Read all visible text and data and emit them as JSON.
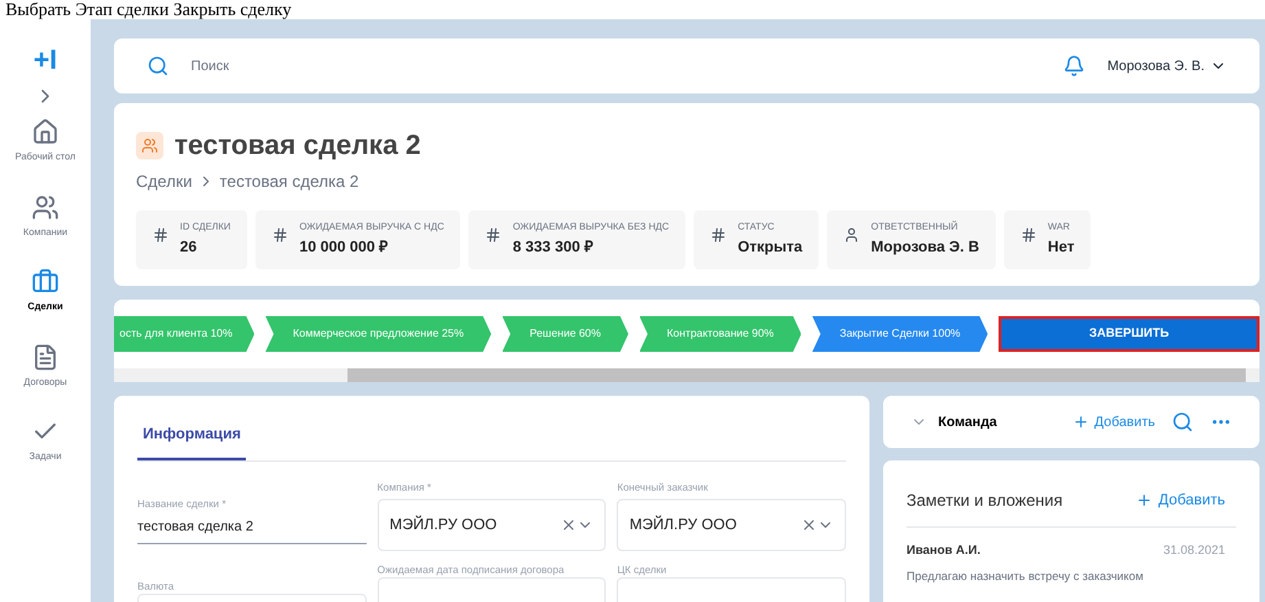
{
  "caption": "Выбрать Этап сделки Закрыть сделку",
  "sidebar": {
    "items": [
      {
        "label": "Рабочий стол",
        "selected": false
      },
      {
        "label": "Компании",
        "selected": false
      },
      {
        "label": "Сделки",
        "selected": true
      },
      {
        "label": "Договоры",
        "selected": false
      },
      {
        "label": "Задачи",
        "selected": false
      }
    ]
  },
  "logo": "+I",
  "search": {
    "placeholder": "Поиск"
  },
  "user": {
    "name": "Морозова Э. В."
  },
  "deal": {
    "title": "тестовая сделка 2",
    "breadcrumbs": [
      "Сделки",
      "тестовая сделка 2"
    ]
  },
  "stats": [
    {
      "label": "ID СДЕЛКИ",
      "value": "26",
      "kind": "number"
    },
    {
      "label": "ОЖИДАЕМАЯ ВЫРУЧКА С НДС",
      "value": "10 000 000 ₽",
      "kind": "number"
    },
    {
      "label": "ОЖИДАЕМАЯ ВЫРУЧКА БЕЗ НДС",
      "value": "8 333 300 ₽",
      "kind": "number"
    },
    {
      "label": "СТАТУС",
      "value": "Открыта",
      "kind": "number"
    },
    {
      "label": "ОТВЕТСТВЕННЫЙ",
      "value": "Морозова Э. В",
      "kind": "person"
    },
    {
      "label": "WAR",
      "value": "Нет",
      "kind": "number"
    }
  ],
  "stages": [
    {
      "label": "ость для клиента 10%",
      "color": "#34c46c"
    },
    {
      "label": "Коммерческое предложение 25%",
      "color": "#34c46c"
    },
    {
      "label": "Решение 60%",
      "color": "#34c46c"
    },
    {
      "label": "Контрактование 90%",
      "color": "#34c46c"
    },
    {
      "label": "Закрытие Сделки 100%",
      "color": "#2589f0"
    }
  ],
  "finish_button": "ЗАВЕРШИТЬ",
  "info": {
    "tabs": [
      {
        "label": "Информация",
        "selected": true
      }
    ],
    "fields": [
      {
        "kind": "text",
        "label": "Название сделки *",
        "value": "тестовая сделка 2"
      },
      {
        "kind": "select",
        "label": "Компания *",
        "value": "МЭЙЛ.РУ ООО"
      },
      {
        "kind": "select",
        "label": "Конечный заказчик",
        "value": "МЭЙЛ.РУ ООО"
      },
      {
        "kind": "text",
        "label": "Валюта"
      },
      {
        "kind": "text",
        "label": "Ожидаемая дата подписания договора"
      },
      {
        "kind": "text",
        "label": "ЦК сделки"
      }
    ]
  },
  "team": {
    "title": "Команда",
    "add": "Добавить"
  },
  "notes": {
    "title": "Заметки и вложения",
    "add": "Добавить",
    "items": [
      {
        "author": "Иванов А.И.",
        "date": "31.08.2021",
        "text": "Предлагаю назначить встречу с заказчиком"
      }
    ]
  }
}
